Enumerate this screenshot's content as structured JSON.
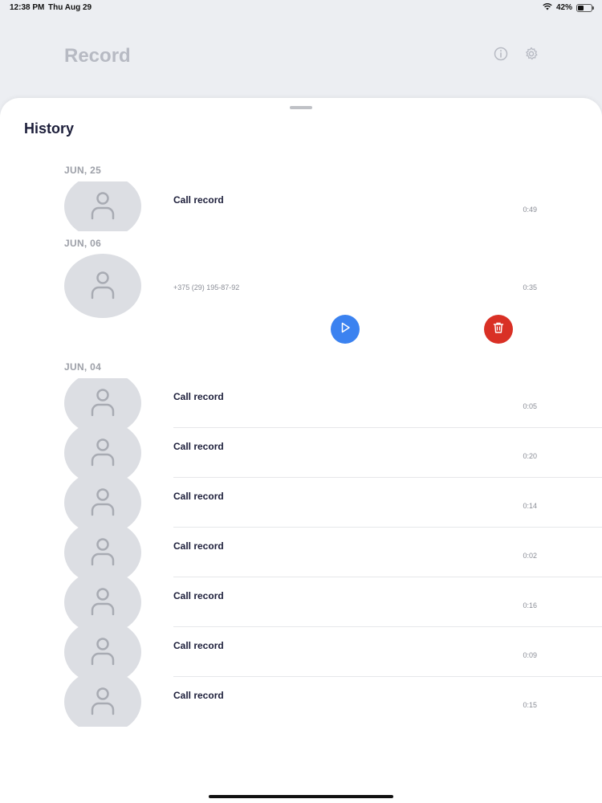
{
  "status_bar": {
    "time": "12:38 PM",
    "date": "Thu Aug 29",
    "battery": "42%",
    "battery_level": 0.42
  },
  "header": {
    "title": "Record",
    "info_icon": "info-icon",
    "settings_icon": "gear-icon"
  },
  "history": {
    "title": "History",
    "groups": [
      {
        "date": "JUN, 25",
        "items": [
          {
            "title": "Call record",
            "duration": "0:49"
          }
        ]
      },
      {
        "date": "JUN, 06",
        "items": [
          {
            "subtitle": "+375 (29) 195-87-92",
            "duration": "0:35"
          }
        ]
      },
      {
        "date": "JUN, 04",
        "items": [
          {
            "title": "Call record",
            "duration": "0:05"
          },
          {
            "title": "Call record",
            "duration": "0:20"
          },
          {
            "title": "Call record",
            "duration": "0:14"
          },
          {
            "title": "Call record",
            "duration": "0:02"
          },
          {
            "title": "Call record",
            "duration": "0:16"
          },
          {
            "title": "Call record",
            "duration": "0:09"
          },
          {
            "title": "Call record",
            "duration": "0:15"
          }
        ]
      }
    ]
  },
  "actions": {
    "play_icon": "play-icon",
    "delete_icon": "trash-icon",
    "play_color": "#3b82f0",
    "delete_color": "#d93025"
  },
  "colors": {
    "accent_text": "#1c1e3a",
    "muted": "#9da0a8",
    "avatar_bg": "#dcdee3"
  }
}
